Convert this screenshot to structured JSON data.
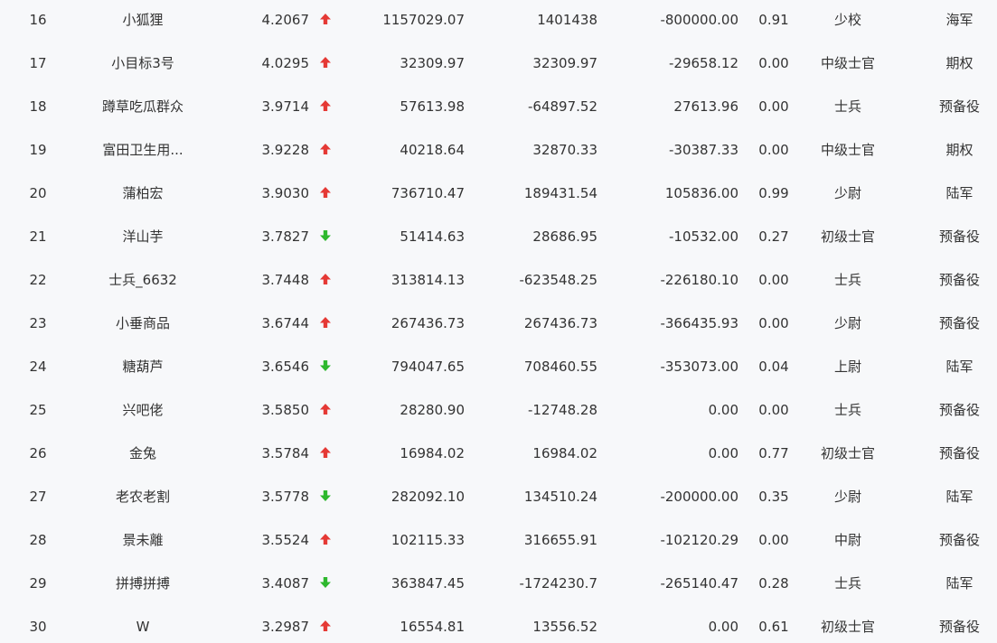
{
  "colors": {
    "up": "#e53935",
    "down": "#2eb82e",
    "text": "#333333",
    "background": "#f7f8fa"
  },
  "rows": [
    {
      "rank": "16",
      "name": "小狐狸",
      "score": "4.2067",
      "trend": "up",
      "trend_icon": "arrow-up-icon",
      "v1": "1157029.07",
      "v2": "1401438",
      "v3": "-800000.00",
      "ratio": "0.91",
      "military_rank": "少校",
      "branch": "海军"
    },
    {
      "rank": "17",
      "name": "小目标3号",
      "score": "4.0295",
      "trend": "up",
      "trend_icon": "arrow-up-icon",
      "v1": "32309.97",
      "v2": "32309.97",
      "v3": "-29658.12",
      "ratio": "0.00",
      "military_rank": "中级士官",
      "branch": "期权"
    },
    {
      "rank": "18",
      "name": "蹲草吃瓜群众",
      "score": "3.9714",
      "trend": "up",
      "trend_icon": "arrow-up-icon",
      "v1": "57613.98",
      "v2": "-64897.52",
      "v3": "27613.96",
      "ratio": "0.00",
      "military_rank": "士兵",
      "branch": "预备役"
    },
    {
      "rank": "19",
      "name": "富田卫生用...",
      "score": "3.9228",
      "trend": "up",
      "trend_icon": "arrow-up-icon",
      "v1": "40218.64",
      "v2": "32870.33",
      "v3": "-30387.33",
      "ratio": "0.00",
      "military_rank": "中级士官",
      "branch": "期权"
    },
    {
      "rank": "20",
      "name": "蒲柏宏",
      "score": "3.9030",
      "trend": "up",
      "trend_icon": "arrow-up-icon",
      "v1": "736710.47",
      "v2": "189431.54",
      "v3": "105836.00",
      "ratio": "0.99",
      "military_rank": "少尉",
      "branch": "陆军"
    },
    {
      "rank": "21",
      "name": "洋山芋",
      "score": "3.7827",
      "trend": "down",
      "trend_icon": "arrow-down-icon",
      "v1": "51414.63",
      "v2": "28686.95",
      "v3": "-10532.00",
      "ratio": "0.27",
      "military_rank": "初级士官",
      "branch": "预备役"
    },
    {
      "rank": "22",
      "name": "士兵_6632",
      "score": "3.7448",
      "trend": "up",
      "trend_icon": "arrow-up-icon",
      "v1": "313814.13",
      "v2": "-623548.25",
      "v3": "-226180.10",
      "ratio": "0.00",
      "military_rank": "士兵",
      "branch": "预备役"
    },
    {
      "rank": "23",
      "name": "小垂商品",
      "score": "3.6744",
      "trend": "up",
      "trend_icon": "arrow-up-icon",
      "v1": "267436.73",
      "v2": "267436.73",
      "v3": "-366435.93",
      "ratio": "0.00",
      "military_rank": "少尉",
      "branch": "预备役"
    },
    {
      "rank": "24",
      "name": "糖葫芦",
      "score": "3.6546",
      "trend": "down",
      "trend_icon": "arrow-down-icon",
      "v1": "794047.65",
      "v2": "708460.55",
      "v3": "-353073.00",
      "ratio": "0.04",
      "military_rank": "上尉",
      "branch": "陆军"
    },
    {
      "rank": "25",
      "name": "兴吧佬",
      "score": "3.5850",
      "trend": "up",
      "trend_icon": "arrow-up-icon",
      "v1": "28280.90",
      "v2": "-12748.28",
      "v3": "0.00",
      "ratio": "0.00",
      "military_rank": "士兵",
      "branch": "预备役"
    },
    {
      "rank": "26",
      "name": "金兔",
      "score": "3.5784",
      "trend": "up",
      "trend_icon": "arrow-up-icon",
      "v1": "16984.02",
      "v2": "16984.02",
      "v3": "0.00",
      "ratio": "0.77",
      "military_rank": "初级士官",
      "branch": "预备役"
    },
    {
      "rank": "27",
      "name": "老农老割",
      "score": "3.5778",
      "trend": "down",
      "trend_icon": "arrow-down-icon",
      "v1": "282092.10",
      "v2": "134510.24",
      "v3": "-200000.00",
      "ratio": "0.35",
      "military_rank": "少尉",
      "branch": "陆军"
    },
    {
      "rank": "28",
      "name": "景未離",
      "score": "3.5524",
      "trend": "up",
      "trend_icon": "arrow-up-icon",
      "v1": "102115.33",
      "v2": "316655.91",
      "v3": "-102120.29",
      "ratio": "0.00",
      "military_rank": "中尉",
      "branch": "预备役"
    },
    {
      "rank": "29",
      "name": "拼搏拼搏",
      "score": "3.4087",
      "trend": "down",
      "trend_icon": "arrow-down-icon",
      "v1": "363847.45",
      "v2": "-1724230.7",
      "v3": "-265140.47",
      "ratio": "0.28",
      "military_rank": "士兵",
      "branch": "陆军"
    },
    {
      "rank": "30",
      "name": "W",
      "score": "3.2987",
      "trend": "up",
      "trend_icon": "arrow-up-icon",
      "v1": "16554.81",
      "v2": "13556.52",
      "v3": "0.00",
      "ratio": "0.61",
      "military_rank": "初级士官",
      "branch": "预备役"
    }
  ]
}
